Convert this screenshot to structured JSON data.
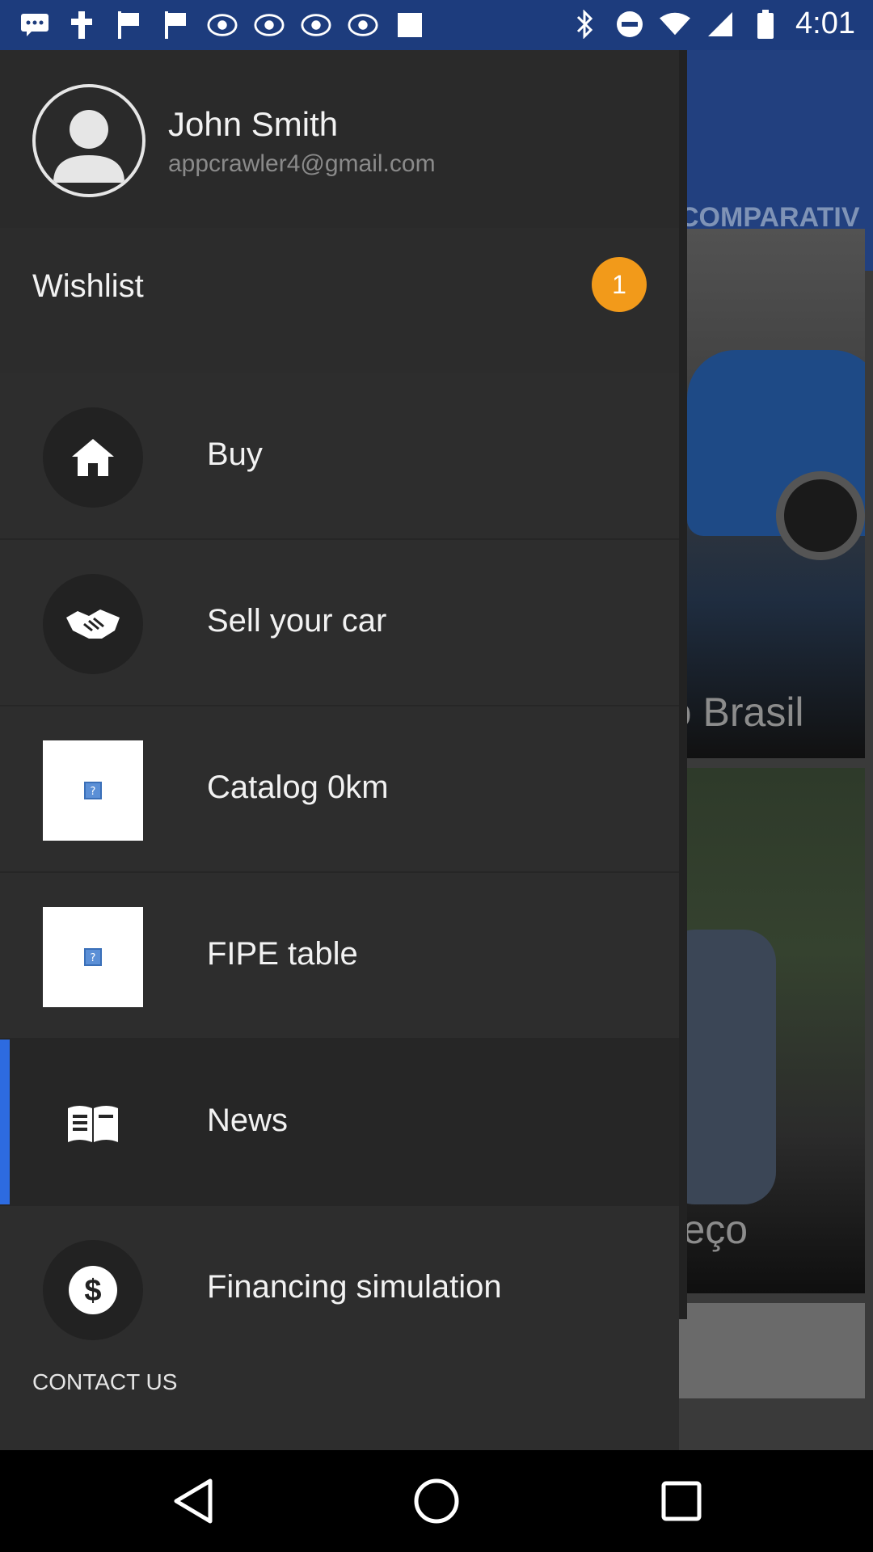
{
  "status_bar": {
    "time": "4:01",
    "icons": [
      "chat-icon",
      "cross-icon",
      "flag-icon",
      "flag-icon",
      "abc13-icon",
      "abc13-icon",
      "abc13-icon",
      "abc13-icon",
      "square-icon",
      "bluetooth-icon",
      "do-not-disturb-icon",
      "wifi-icon",
      "signal-icon",
      "battery-icon"
    ]
  },
  "background": {
    "tab_label": "COMPARATIV",
    "card1_text": "no Brasil",
    "card2_text": "preço"
  },
  "drawer": {
    "profile": {
      "name": "John Smith",
      "email": "appcrawler4@gmail.com"
    },
    "wishlist": {
      "label": "Wishlist",
      "count": "1",
      "badge_color": "#f29a1a"
    },
    "menu": [
      {
        "label": "Buy",
        "icon": "home-icon"
      },
      {
        "label": "Sell your car",
        "icon": "handshake-icon"
      },
      {
        "label": "Catalog 0km",
        "icon": "broken-image-icon"
      },
      {
        "label": "FIPE table",
        "icon": "broken-image-icon"
      },
      {
        "label": "News",
        "icon": "newspaper-icon",
        "active": true
      },
      {
        "label": "Financing simulation",
        "icon": "dollar-icon"
      }
    ],
    "contact_label": "CONTACT US",
    "accent_color": "#2d6be0"
  },
  "nav_bar": {
    "buttons": [
      "back-icon",
      "home-icon",
      "recents-icon"
    ]
  }
}
